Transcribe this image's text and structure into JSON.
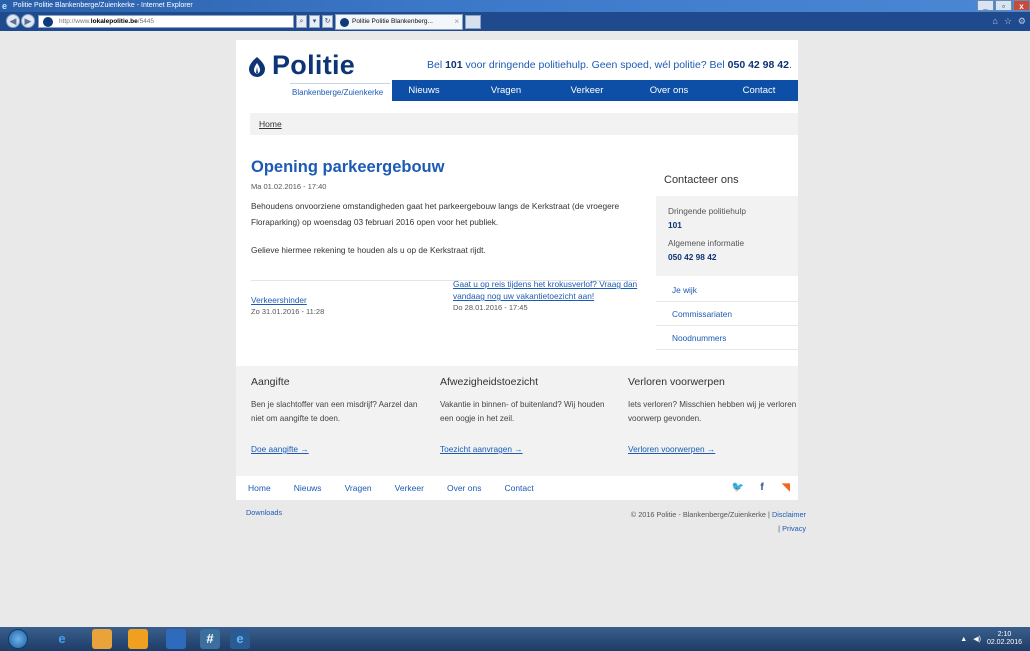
{
  "window": {
    "title": "Politie Politie Blankenberge/Zuienkerke - Internet Explorer",
    "buttons": {
      "minimize": "_",
      "maximize": "▫",
      "close": "x"
    }
  },
  "browser": {
    "address_prefix": "http://www.",
    "address_domain": "lokalepolitie.be",
    "address_path": "/5445",
    "tab_title": "Politie Politie Blankenberg...",
    "search_glyph": "⌕",
    "dropdown_glyph": "▾",
    "refresh_glyph": "↻",
    "tab_close": "×"
  },
  "header": {
    "logo_text": "Politie",
    "logo_sub": "Blankenberge/Zuienkerke",
    "emergency": {
      "pre": "Bel ",
      "num1": "101",
      "mid": " voor dringende politiehulp. Geen spoed, wél politie? Bel ",
      "num2": "050 42 98 42",
      "post": "."
    },
    "nav": [
      "Nieuws",
      "Vragen",
      "Verkeer",
      "Over ons",
      "Contact"
    ]
  },
  "breadcrumb": {
    "home": "Home"
  },
  "article": {
    "title": "Opening parkeergebouw",
    "date": "Ma 01.02.2016 - 17:40",
    "para1": "Behoudens onvoorziene omstandigheden gaat het parkeergebouw langs de Kerkstraat (de vroegere Floraparking) op woensdag 03 februari 2016 open voor het publiek.",
    "para2": "Gelieve hiermee rekening te houden als u op de Kerkstraat rijdt."
  },
  "related": [
    {
      "title": "Verkeershinder",
      "date": "Zo 31.01.2016 - 11:28"
    },
    {
      "title": "Gaat u op reis tijdens het krokusverlof? Vraag dan vandaag nog uw vakantietoezicht aan!",
      "date": "Do 28.01.2016 - 17:45"
    }
  ],
  "sidebar": {
    "title": "Contacteer ons",
    "urgent_label": "Dringende politiehulp",
    "urgent_number": "101",
    "general_label": "Algemene informatie",
    "general_number": "050 42 98 42",
    "links": [
      "Je wijk",
      "Commissariaten",
      "Noodnummers"
    ]
  },
  "columns": [
    {
      "title": "Aangifte",
      "text": "Ben je slachtoffer van een misdrijf? Aarzel dan niet om aangifte te doen.",
      "link": "Doe aangifte →"
    },
    {
      "title": "Afwezigheidstoezicht",
      "text": "Vakantie in binnen- of buitenland? Wij houden een oogje in het zeil.",
      "link": "Toezicht aanvragen →"
    },
    {
      "title": "Verloren voorwerpen",
      "text": "Iets verloren? Misschien hebben wij je verloren voorwerp gevonden.",
      "link": "Verloren voorwerpen →"
    }
  ],
  "footer_nav": [
    "Home",
    "Nieuws",
    "Vragen",
    "Verkeer",
    "Over ons",
    "Contact"
  ],
  "social": {
    "twitter": "🐦",
    "facebook": "f",
    "rss": "◥"
  },
  "footer": {
    "downloads": "Downloads",
    "copyright": "© 2016 Politie - Blankenberge/Zuienkerke",
    "separator": " | ",
    "disclaimer": "Disclaimer",
    "privacy": "Privacy"
  },
  "taskbar": {
    "clock_time": "2:10",
    "clock_date": "02.02.2016",
    "tray_arrow": "▲",
    "tray_volume": "◀)"
  },
  "colors": {
    "brand_dark": "#0d3576",
    "brand_nav": "#0d4fa6",
    "link": "#1c5bb5",
    "twitter": "#1da1f2",
    "facebook": "#2d4f8e",
    "rss": "#f26522"
  }
}
